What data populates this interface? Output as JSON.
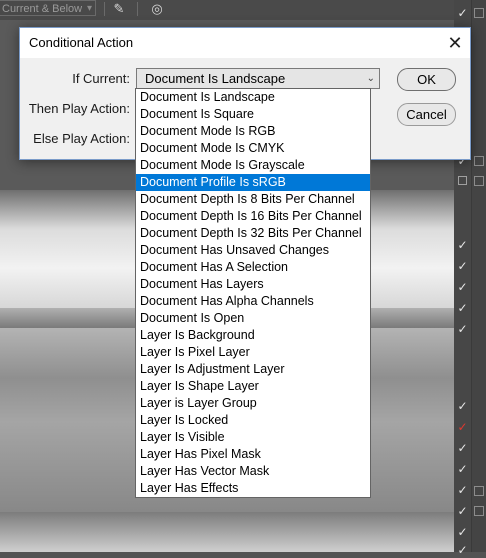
{
  "toolbar": {
    "sample_mode": "Current & Below",
    "icons": [
      "brush-icon",
      "ignore-adjustment-icon",
      "sample-all-icon"
    ]
  },
  "dialog": {
    "title": "Conditional Action",
    "if_current_label": "If Current:",
    "then_play_label": "Then Play Action:",
    "else_play_label": "Else Play Action:",
    "if_current_value": "Document Is Landscape",
    "ok_label": "OK",
    "cancel_label": "Cancel"
  },
  "dropdown": {
    "selected_index": 5,
    "options": [
      "Document Is Landscape",
      "Document Is Square",
      "Document Mode Is RGB",
      "Document Mode Is CMYK",
      "Document Mode Is Grayscale",
      "Document Profile Is sRGB",
      "Document Depth Is 8 Bits Per Channel",
      "Document Depth Is 16 Bits Per Channel",
      "Document Depth Is 32 Bits Per Channel",
      "Document Has Unsaved Changes",
      "Document Has A Selection",
      "Document Has Layers",
      "Document Has Alpha Channels",
      "Document Is Open",
      "Layer Is Background",
      "Layer Is Pixel Layer",
      "Layer Is Adjustment Layer",
      "Layer Is Shape Layer",
      "Layer is Layer Group",
      "Layer Is Locked",
      "Layer Is Visible",
      "Layer Has Pixel Mask",
      "Layer Has Vector Mask",
      "Layer Has Effects"
    ]
  },
  "colors": {
    "selection": "#0078d7",
    "check_red": "#e0382f"
  }
}
